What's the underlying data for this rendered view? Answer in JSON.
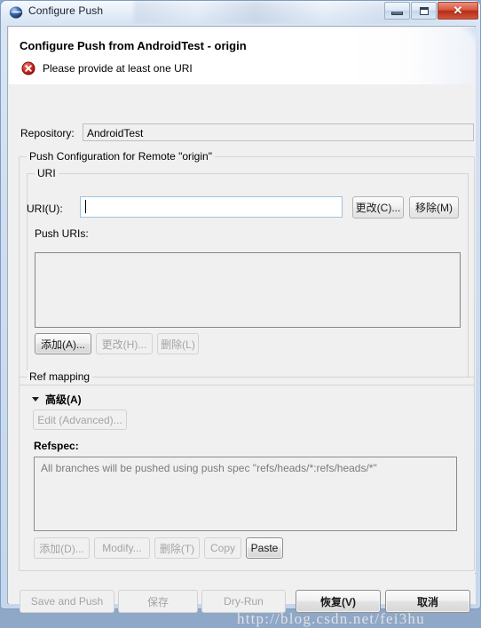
{
  "window": {
    "title": "Configure Push",
    "app_icon": "eclipse-globe-icon",
    "controls": {
      "minimize_label": "Minimize",
      "maximize_label": "Maximize",
      "close_label": "✕"
    }
  },
  "header": {
    "title": "Configure Push from AndroidTest - origin",
    "error_icon": "error-circle-icon",
    "error_message": "Please provide at least one URI"
  },
  "repository": {
    "label": "Repository:",
    "value": "AndroidTest"
  },
  "push_config_group": {
    "title": "Push Configuration for Remote \"origin\"",
    "uri_group": {
      "title": "URI",
      "uri_label": "URI(U):",
      "uri_value": "",
      "uri_placeholder": "",
      "change_button": "更改(C)...",
      "remove_button": "移除(M)",
      "push_uris_label": "Push URIs:",
      "push_uris_items": [],
      "add_button": "添加(A)...",
      "modify_button": "更改(H)...",
      "delete_button": "删除(L)"
    }
  },
  "ref_mapping_group": {
    "title": "Ref mapping",
    "advanced_toggle": "高级(A)",
    "advanced_toggle_icon": "chevron-down-icon",
    "edit_advanced_button": "Edit (Advanced)...",
    "refspec_label": "Refspec:",
    "refspec_text": "All branches will be pushed using push spec \"refs/heads/*:refs/heads/*\"",
    "add_button": "添加(D)...",
    "modify_button": "Modify...",
    "delete_button": "删除(T)",
    "copy_button": "Copy",
    "paste_button": "Paste"
  },
  "footer": {
    "save_and_push_button": "Save and Push",
    "save_button": "保存",
    "dry_run_button": "Dry-Run",
    "restore_button": "恢复(V)",
    "cancel_button": "取消"
  },
  "watermark": "http://blog.csdn.net/fei3hu",
  "colors": {
    "accent": "#3a6ea5",
    "error": "#cc2222",
    "dialog_bg": "#f0f0f0",
    "header_bg": "#ffffff",
    "close_button": "#c0392b"
  }
}
